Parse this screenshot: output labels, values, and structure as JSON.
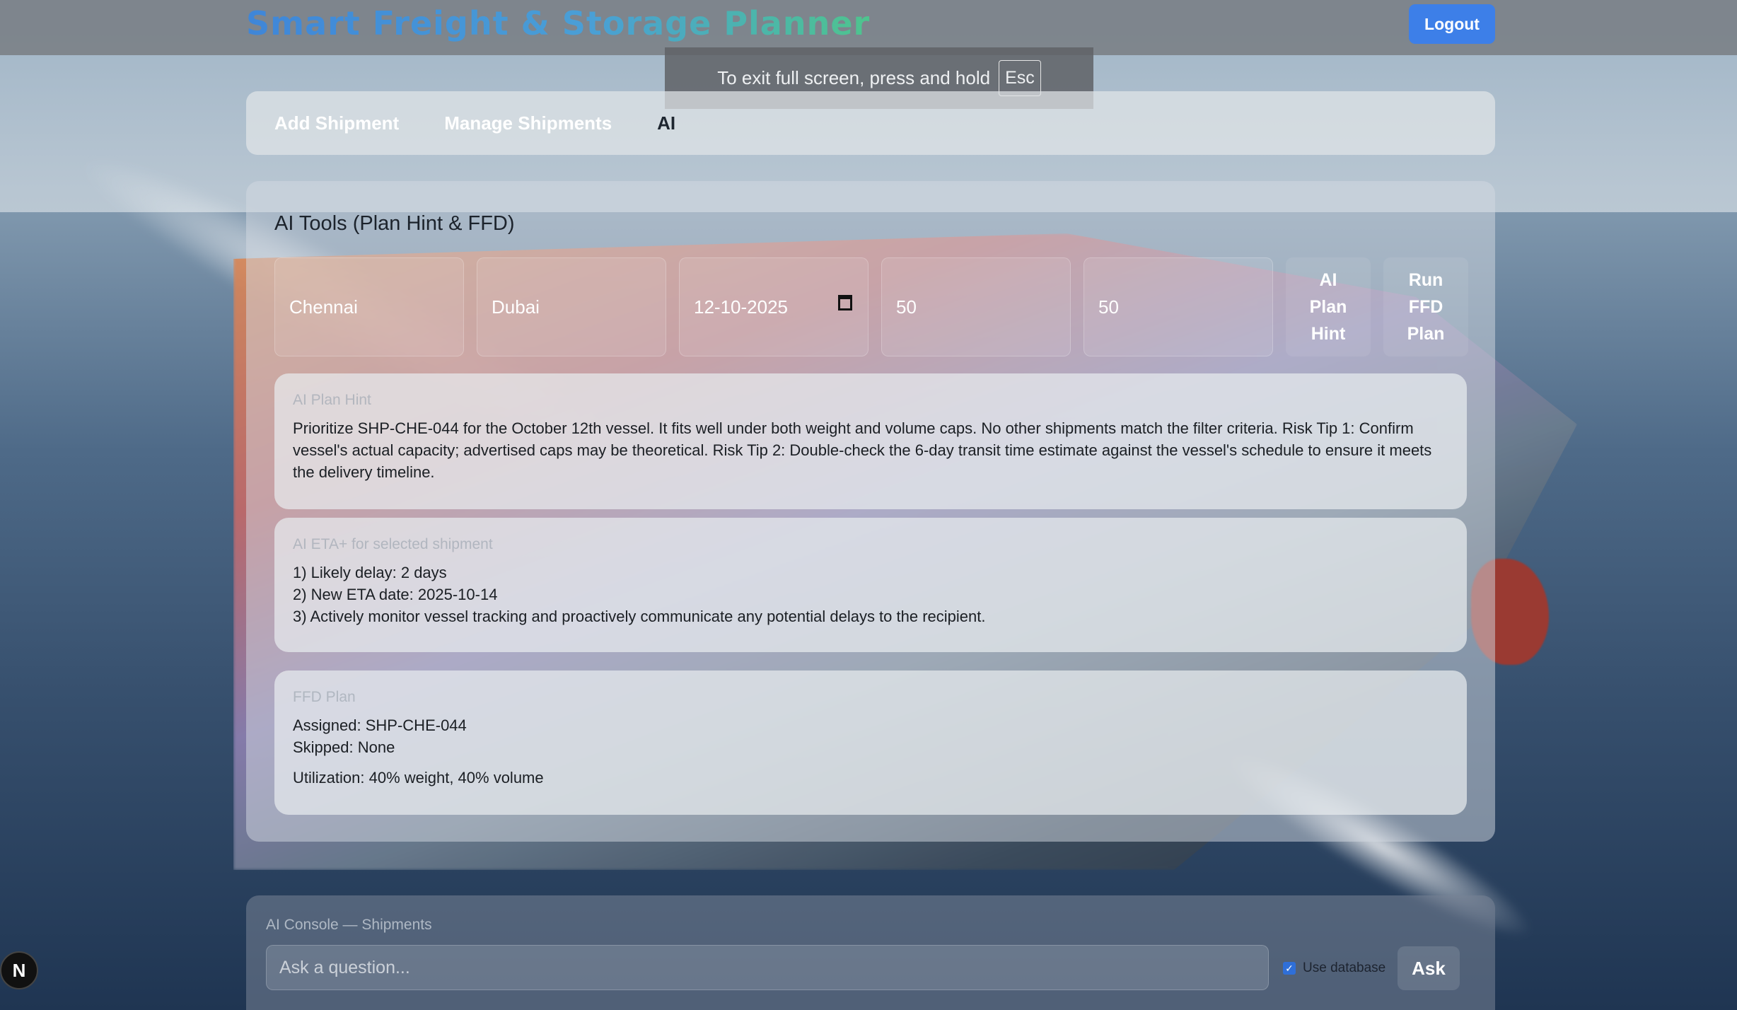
{
  "header": {
    "title": "Smart Freight & Storage Planner",
    "account_text": "",
    "logout_label": "Logout"
  },
  "fullscreen_notice": {
    "text": "To exit full screen, press and hold",
    "key": "Esc"
  },
  "tabs": [
    {
      "label": "Add Shipment",
      "active": false
    },
    {
      "label": "Manage Shipments",
      "active": false
    },
    {
      "label": "AI",
      "active": true
    }
  ],
  "ai_tools": {
    "title": "AI Tools (Plan Hint & FFD)",
    "fields": {
      "origin": "Chennai",
      "destination": "Dubai",
      "date": "12-10-2025",
      "weight_cap": "50",
      "volume_cap": "50"
    },
    "buttons": {
      "plan_hint": [
        "AI",
        "Plan",
        "Hint"
      ],
      "run_ffd": [
        "Run",
        "FFD",
        "Plan"
      ]
    },
    "plan_hint": {
      "label": "AI Plan Hint",
      "text": "Prioritize SHP-CHE-044 for the October 12th vessel.  It fits well under both weight and volume caps.  No other shipments match the filter criteria.  Risk Tip 1: Confirm vessel's actual capacity; advertised caps may be theoretical. Risk Tip 2: Double-check the 6-day transit time estimate against the vessel's schedule to ensure it meets the delivery timeline."
    },
    "eta": {
      "label": "AI ETA+ for selected shipment",
      "lines": [
        "1) Likely delay: 2 days",
        "2) New ETA date: 2025-10-14",
        "3)  Actively monitor vessel tracking and proactively communicate any potential delays to the recipient."
      ]
    },
    "ffd": {
      "label": "FFD Plan",
      "assigned": "Assigned: SHP-CHE-044",
      "skipped": "Skipped: None",
      "utilization": "Utilization: 40% weight, 40% volume"
    }
  },
  "console": {
    "label": "AI Console — Shipments",
    "placeholder": "Ask a question...",
    "use_database_label": "Use database",
    "use_database_checked": true,
    "ask_label": "Ask"
  },
  "badge": "N",
  "colors": {
    "accent": "#3d7fe8",
    "title_gradient_start": "#3f86d8",
    "title_gradient_end": "#4ec48e"
  }
}
